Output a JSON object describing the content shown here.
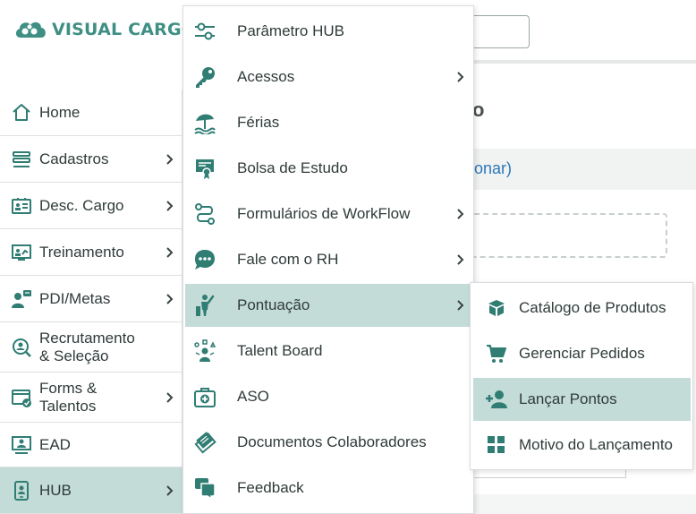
{
  "colors": {
    "brand": "#3f8f84",
    "active_bg": "#c4dcd8",
    "icon": "#2f7d73",
    "link": "#2b78b8"
  },
  "brand": {
    "name": "VISUAL CARGO"
  },
  "background": {
    "title_fragment": "o",
    "link_fragment": "icionar)"
  },
  "sidebar": {
    "items": [
      {
        "label": "Home",
        "icon": "home-icon"
      },
      {
        "label": "Cadastros",
        "icon": "list-icon"
      },
      {
        "label": "Desc. Cargo",
        "icon": "id-card-icon"
      },
      {
        "label": "Treinamento",
        "icon": "presentation-icon"
      },
      {
        "label": "PDI/Metas",
        "icon": "user-goals-icon"
      },
      {
        "label_line1": "Recrutamento",
        "label_line2": "& Seleção",
        "icon": "search-user-icon"
      },
      {
        "label_line1": "Forms &",
        "label_line2": "Talentos",
        "icon": "form-check-icon"
      },
      {
        "label": "EAD",
        "icon": "monitor-user-icon"
      },
      {
        "label": "HUB",
        "icon": "tablet-user-icon",
        "active": true
      }
    ]
  },
  "hub_menu": {
    "items": [
      {
        "label": "Parâmetro HUB",
        "icon": "sliders-icon"
      },
      {
        "label": "Acessos",
        "icon": "key-icon"
      },
      {
        "label": "Férias",
        "icon": "beach-umbrella-icon"
      },
      {
        "label": "Bolsa de Estudo",
        "icon": "certificate-icon"
      },
      {
        "label": "Formulários de WorkFlow",
        "icon": "workflow-icon"
      },
      {
        "label": "Fale com o RH",
        "icon": "chat-bubble-icon"
      },
      {
        "label": "Pontuação",
        "icon": "trophy-person-icon",
        "active": true
      },
      {
        "label": "Talent Board",
        "icon": "talent-icon"
      },
      {
        "label": "ASO",
        "icon": "medical-kit-icon"
      },
      {
        "label": "Documentos Colaboradores",
        "icon": "documents-icon"
      },
      {
        "label": "Feedback",
        "icon": "feedback-icon"
      }
    ]
  },
  "pontuacao_menu": {
    "items": [
      {
        "label": "Catálogo de Produtos",
        "icon": "box-icon"
      },
      {
        "label": "Gerenciar Pedidos",
        "icon": "cart-icon"
      },
      {
        "label": "Lançar Pontos",
        "icon": "add-user-icon",
        "active": true
      },
      {
        "label": "Motivo do Lançamento",
        "icon": "grid-icon"
      }
    ]
  }
}
